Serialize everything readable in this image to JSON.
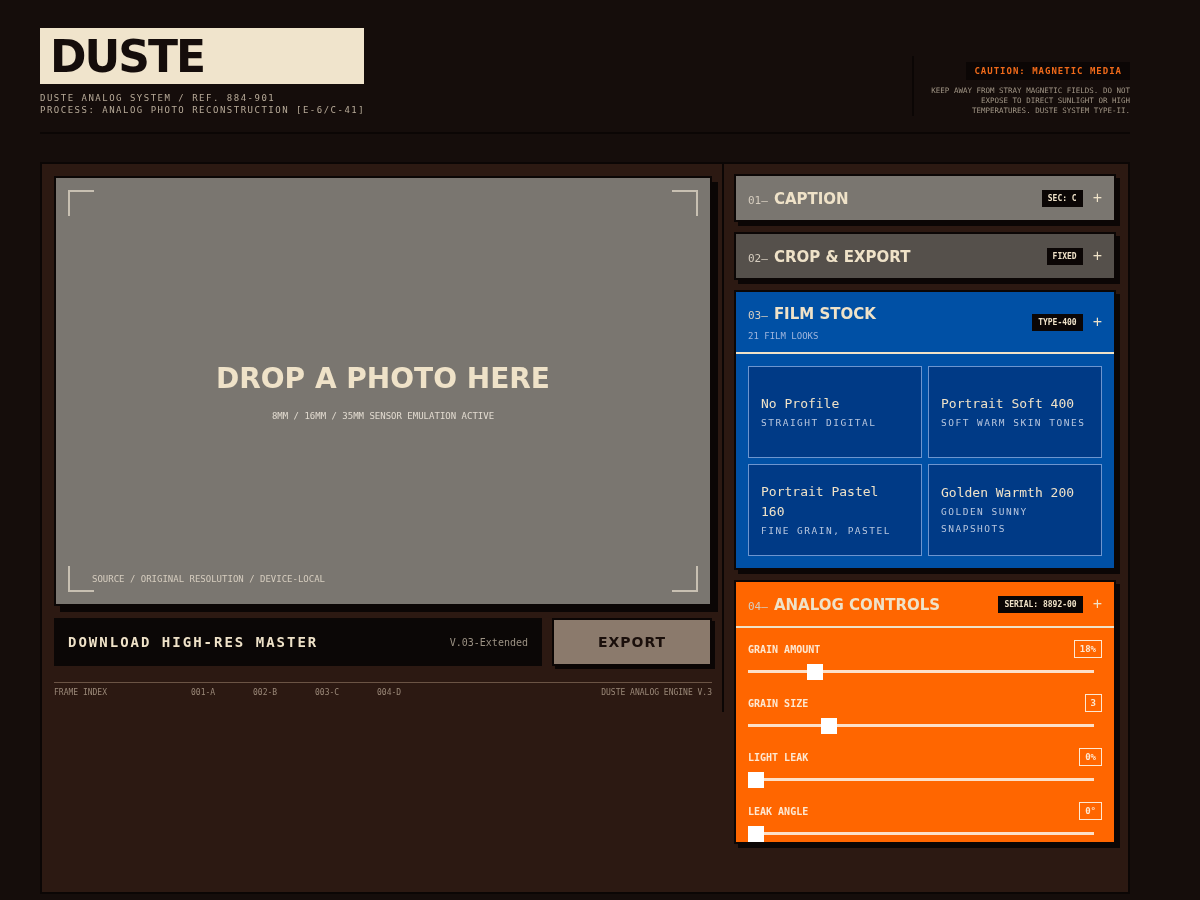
{
  "brand": {
    "logo": "DUSTE",
    "subtitle_lines": [
      "DUSTE ANALOG SYSTEM / REF. 884-901",
      "PROCESS: ANALOG PHOTO RECONSTRUCTION [E-6/C-41]"
    ]
  },
  "caution": {
    "label": "CAUTION: MAGNETIC MEDIA",
    "text": "KEEP AWAY FROM STRAY MAGNETIC FIELDS. DO NOT EXPOSE TO DIRECT SUNLIGHT OR HIGH TEMPERATURES. DUSTE SYSTEM TYPE-II."
  },
  "dropzone": {
    "title": "DROP A PHOTO HERE",
    "subtitle": "8MM / 16MM / 35MM SENSOR EMULATION ACTIVE",
    "source": "SOURCE / ORIGINAL RESOLUTION / DEVICE-LOCAL"
  },
  "download": {
    "label": "DOWNLOAD HIGH-RES MASTER",
    "version": "V.03-Extended",
    "button": "EXPORT"
  },
  "frame_index": {
    "label": "FRAME INDEX",
    "frames": [
      "001-A",
      "002-B",
      "003-C",
      "004-D"
    ],
    "engine": "DUSTE ANALOG ENGINE V.3"
  },
  "sections": [
    {
      "number": "01—",
      "title": "CAPTION",
      "badge": "SEC: C",
      "toggle": "+",
      "color": "#7a7670",
      "expanded": false
    },
    {
      "number": "02—",
      "title": "CROP & EXPORT",
      "badge": "FIXED",
      "toggle": "+",
      "color": "#55504b",
      "expanded": false
    },
    {
      "number": "03—",
      "title": "FILM STOCK",
      "subtitle": "21 FILM LOOKS",
      "badge": "TYPE-400",
      "toggle": "+",
      "color": "#0050a5",
      "expanded": true,
      "kind": "grid",
      "items": [
        {
          "name": "No Profile",
          "desc": "STRAIGHT DIGITAL"
        },
        {
          "name": "Portrait Soft 400",
          "desc": "SOFT WARM SKIN TONES"
        },
        {
          "name": "Portrait Pastel 160",
          "desc": "FINE GRAIN, PASTEL"
        },
        {
          "name": "Golden Warmth 200",
          "desc": "GOLDEN SUNNY SNAPSHOTS"
        }
      ]
    },
    {
      "number": "04—",
      "title": "ANALOG CONTROLS",
      "badge": "SERIAL: 8892-00",
      "toggle": "+",
      "color": "#ff6600",
      "expanded": true,
      "kind": "sliders",
      "items": [
        {
          "name": "GRAIN AMOUNT",
          "value": "18%",
          "level": 0.18
        },
        {
          "name": "GRAIN SIZE",
          "value": "3",
          "level": 0.22
        },
        {
          "name": "LIGHT LEAK",
          "value": "0%",
          "level": 0
        },
        {
          "name": "LEAK ANGLE",
          "value": "0°",
          "level": 0
        }
      ]
    }
  ]
}
